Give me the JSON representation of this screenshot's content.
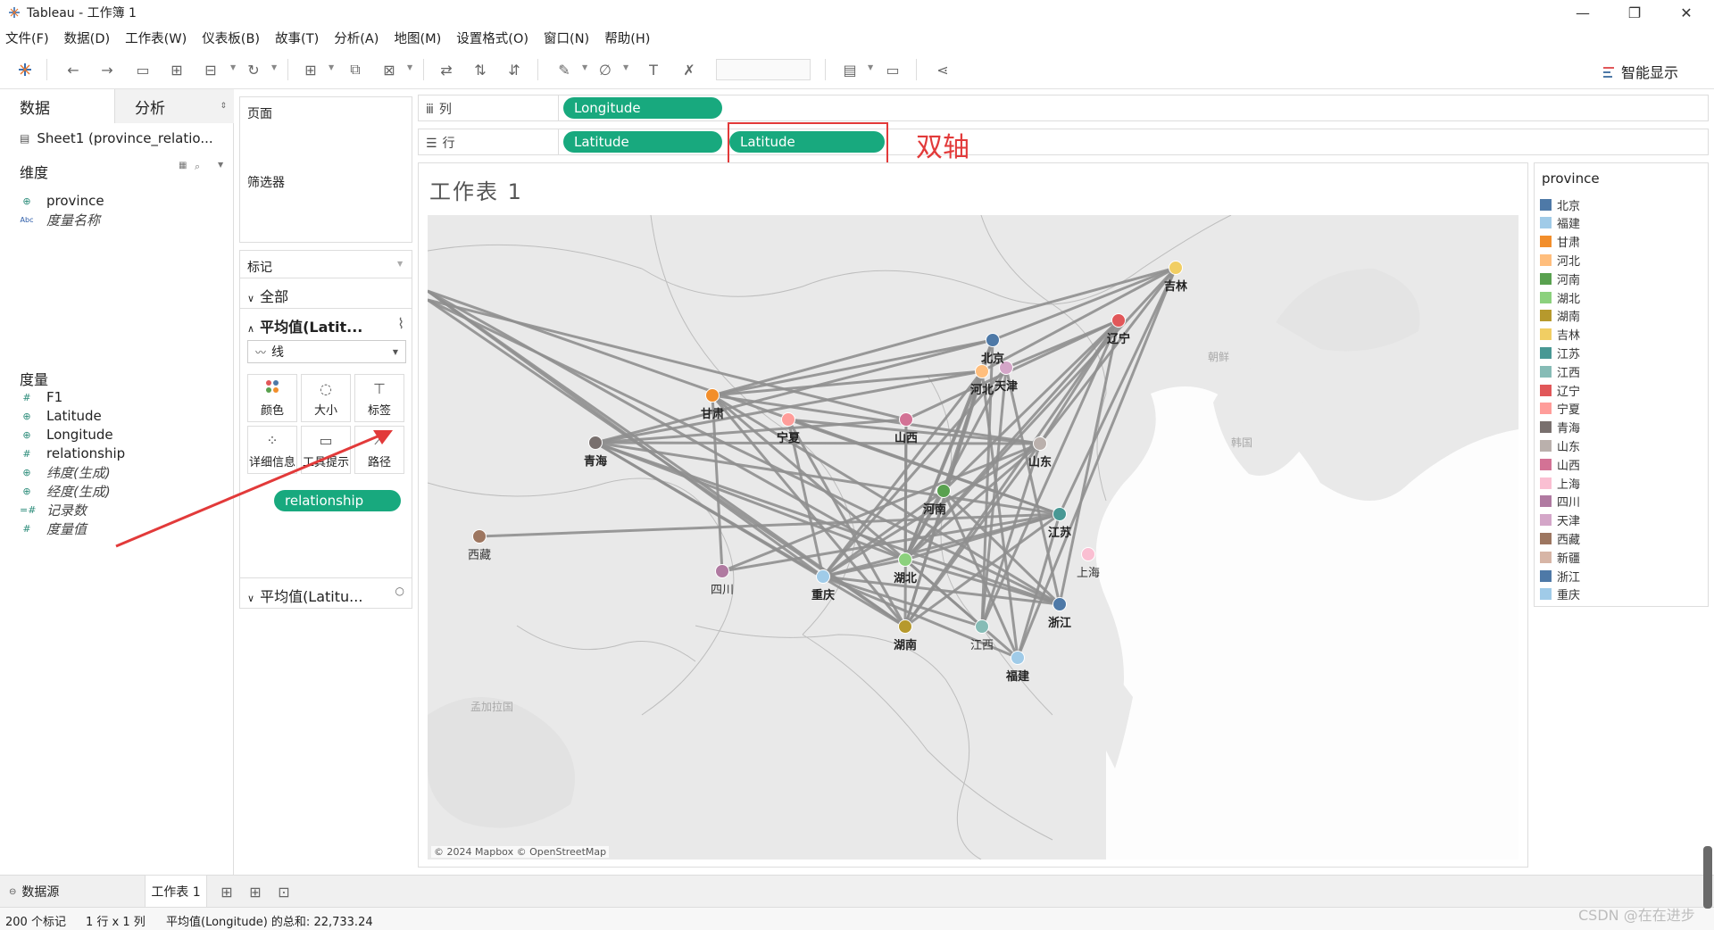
{
  "window": {
    "title": "Tableau - 工作簿 1",
    "minimize": "—",
    "maximize": "❐",
    "close": "✕"
  },
  "menu": [
    "文件(F)",
    "数据(D)",
    "工作表(W)",
    "仪表板(B)",
    "故事(T)",
    "分析(A)",
    "地图(M)",
    "设置格式(O)",
    "窗口(N)",
    "帮助(H)"
  ],
  "toolbar": {
    "show_me": "智能显示"
  },
  "left_pane": {
    "tab_data": "数据",
    "tab_analysis": "分析",
    "datasource": "Sheet1 (province_relatio...",
    "dimensions_header": "维度",
    "dimensions": [
      {
        "icon": "⊕",
        "label": "province",
        "italic": false
      },
      {
        "icon": "Abc",
        "label": "度量名称",
        "italic": true
      }
    ],
    "measures_header": "度量",
    "measures": [
      {
        "icon": "#",
        "label": "F1",
        "italic": false
      },
      {
        "icon": "⊕",
        "label": "Latitude",
        "italic": false
      },
      {
        "icon": "⊕",
        "label": "Longitude",
        "italic": false
      },
      {
        "icon": "#",
        "label": "relationship",
        "italic": false
      },
      {
        "icon": "⊕",
        "label": "纬度(生成)",
        "italic": true
      },
      {
        "icon": "⊕",
        "label": "经度(生成)",
        "italic": true
      },
      {
        "icon": "=#",
        "label": "记录数",
        "italic": true
      },
      {
        "icon": "#",
        "label": "度量值",
        "italic": true
      }
    ]
  },
  "cards": {
    "pages": "页面",
    "filters": "筛选器",
    "marks": "标记",
    "all": "全部",
    "avg_lat_1": "平均值(Latit...",
    "mark_type": "线",
    "buttons": {
      "color": "颜色",
      "size": "大小",
      "label": "标签",
      "detail": "详细信息",
      "tooltip": "工具提示",
      "path": "路径"
    },
    "path_pill": "relationship",
    "avg_lat_2": "平均值(Latitu..."
  },
  "shelves": {
    "columns_label": "列",
    "rows_label": "行",
    "columns_pill": "Longitude",
    "rows_pill_1": "Latitude",
    "rows_pill_2": "Latitude",
    "annotation": "双轴"
  },
  "viz": {
    "sheet_title": "工作表 1",
    "map_copyright": "© 2024 Mapbox © OpenStreetMap",
    "bg_labels": [
      "朝鲜",
      "韩国",
      "孟加拉国"
    ],
    "cities": [
      {
        "name": "北京",
        "color": "#4e79a7",
        "bold": true
      },
      {
        "name": "天津",
        "color": "#d4a6c8",
        "bold": true
      },
      {
        "name": "河北",
        "color": "#ffbe7d",
        "bold": true
      },
      {
        "name": "辽宁",
        "color": "#e15759",
        "bold": true
      },
      {
        "name": "吉林",
        "color": "#f1ce63",
        "bold": true
      },
      {
        "name": "甘肃",
        "color": "#f28e2b",
        "bold": true
      },
      {
        "name": "宁夏",
        "color": "#ff9d9a",
        "bold": true
      },
      {
        "name": "山西",
        "color": "#d37295",
        "bold": true
      },
      {
        "name": "青海",
        "color": "#79706e",
        "bold": true
      },
      {
        "name": "山东",
        "color": "#bab0ac",
        "bold": true
      },
      {
        "name": "河南",
        "color": "#59a14f",
        "bold": true
      },
      {
        "name": "江苏",
        "color": "#499894",
        "bold": true
      },
      {
        "name": "上海",
        "color": "#fabfd2",
        "bold": false
      },
      {
        "name": "西藏",
        "color": "#9d7660",
        "bold": false
      },
      {
        "name": "四川",
        "color": "#b07aa1",
        "bold": false
      },
      {
        "name": "重庆",
        "color": "#a0cbe8",
        "bold": true
      },
      {
        "name": "湖北",
        "color": "#8cd17d",
        "bold": true
      },
      {
        "name": "湖南",
        "color": "#b6992d",
        "bold": true
      },
      {
        "name": "江西",
        "color": "#86bcb6",
        "bold": false
      },
      {
        "name": "浙江",
        "color": "#4e79a7",
        "bold": true
      },
      {
        "name": "福建",
        "color": "#a0cbe8",
        "bold": true
      }
    ],
    "links": [
      [
        "新疆A",
        "湖北"
      ],
      [
        "新疆A",
        "重庆"
      ],
      [
        "新疆A",
        "湖南"
      ],
      [
        "新疆A",
        "江苏"
      ],
      [
        "新疆B",
        "山西"
      ],
      [
        "新疆B",
        "浙江"
      ],
      [
        "新疆B",
        "湖南"
      ],
      [
        "吉林",
        "北京"
      ],
      [
        "吉林",
        "甘肃"
      ],
      [
        "吉林",
        "河北"
      ],
      [
        "吉林",
        "江苏"
      ],
      [
        "吉林",
        "山东"
      ],
      [
        "吉林",
        "湖北"
      ],
      [
        "吉林",
        "福建"
      ],
      [
        "辽宁",
        "天津"
      ],
      [
        "辽宁",
        "山西"
      ],
      [
        "辽宁",
        "湖北"
      ],
      [
        "辽宁",
        "湖南"
      ],
      [
        "辽宁",
        "江西"
      ],
      [
        "辽宁",
        "浙江"
      ],
      [
        "辽宁",
        "山东"
      ],
      [
        "辽宁",
        "河南"
      ],
      [
        "北京",
        "甘肃"
      ],
      [
        "北京",
        "青海"
      ],
      [
        "北京",
        "湖北"
      ],
      [
        "北京",
        "江西"
      ],
      [
        "北京",
        "河南"
      ],
      [
        "北京",
        "湖南"
      ],
      [
        "天津",
        "湖北"
      ],
      [
        "天津",
        "重庆"
      ],
      [
        "天津",
        "浙江"
      ],
      [
        "天津",
        "江西"
      ],
      [
        "河北",
        "青海"
      ],
      [
        "河北",
        "湖北"
      ],
      [
        "河北",
        "重庆"
      ],
      [
        "河北",
        "湖南"
      ],
      [
        "河北",
        "福建"
      ],
      [
        "甘肃",
        "山东"
      ],
      [
        "甘肃",
        "湖北"
      ],
      [
        "甘肃",
        "湖南"
      ],
      [
        "甘肃",
        "四川"
      ],
      [
        "甘肃",
        "浙江"
      ],
      [
        "甘肃",
        "河北"
      ],
      [
        "宁夏",
        "湖南"
      ],
      [
        "宁夏",
        "重庆"
      ],
      [
        "宁夏",
        "山东"
      ],
      [
        "宁夏",
        "江苏"
      ],
      [
        "青海",
        "江苏"
      ],
      [
        "青海",
        "山东"
      ],
      [
        "青海",
        "湖北"
      ],
      [
        "青海",
        "湖南"
      ],
      [
        "青海",
        "重庆"
      ],
      [
        "青海",
        "浙江"
      ],
      [
        "青海",
        "山西"
      ],
      [
        "山东",
        "湖北"
      ],
      [
        "山东",
        "重庆"
      ],
      [
        "山东",
        "江西"
      ],
      [
        "山东",
        "湖南"
      ],
      [
        "山东",
        "四川"
      ],
      [
        "江苏",
        "重庆"
      ],
      [
        "江苏",
        "湖北"
      ],
      [
        "江苏",
        "湖南"
      ],
      [
        "江苏",
        "福建"
      ],
      [
        "江苏",
        "西藏"
      ],
      [
        "江苏",
        "四川"
      ],
      [
        "河南",
        "重庆"
      ],
      [
        "河南",
        "湖北"
      ],
      [
        "河南",
        "福建"
      ],
      [
        "河南",
        "浙江"
      ],
      [
        "湖北",
        "浙江"
      ],
      [
        "湖北",
        "江西"
      ],
      [
        "湖北",
        "重庆"
      ],
      [
        "湖北",
        "福建"
      ],
      [
        "浙江",
        "重庆"
      ],
      [
        "山西",
        "湖北"
      ],
      [
        "山西",
        "湖南"
      ],
      [
        "重庆",
        "福建"
      ],
      [
        "江西",
        "重庆"
      ]
    ]
  },
  "legend": {
    "title": "province",
    "items": [
      {
        "label": "北京",
        "color": "#4e79a7"
      },
      {
        "label": "福建",
        "color": "#a0cbe8"
      },
      {
        "label": "甘肃",
        "color": "#f28e2b"
      },
      {
        "label": "河北",
        "color": "#ffbe7d"
      },
      {
        "label": "河南",
        "color": "#59a14f"
      },
      {
        "label": "湖北",
        "color": "#8cd17d"
      },
      {
        "label": "湖南",
        "color": "#b6992d"
      },
      {
        "label": "吉林",
        "color": "#f1ce63"
      },
      {
        "label": "江苏",
        "color": "#499894"
      },
      {
        "label": "江西",
        "color": "#86bcb6"
      },
      {
        "label": "辽宁",
        "color": "#e15759"
      },
      {
        "label": "宁夏",
        "color": "#ff9d9a"
      },
      {
        "label": "青海",
        "color": "#79706e"
      },
      {
        "label": "山东",
        "color": "#bab0ac"
      },
      {
        "label": "山西",
        "color": "#d37295"
      },
      {
        "label": "上海",
        "color": "#fabfd2"
      },
      {
        "label": "四川",
        "color": "#b07aa1"
      },
      {
        "label": "天津",
        "color": "#d4a6c8"
      },
      {
        "label": "西藏",
        "color": "#9d7660"
      },
      {
        "label": "新疆",
        "color": "#d7b5a6"
      },
      {
        "label": "浙江",
        "color": "#4e79a7"
      },
      {
        "label": "重庆",
        "color": "#a0cbe8"
      }
    ]
  },
  "bottom": {
    "datasource_tab": "数据源",
    "sheet_tab": "工作表 1",
    "status_marks": "200 个标记",
    "status_rows": "1 行 x 1 列",
    "status_sum": "平均值(Longitude) 的总和: 22,733.24",
    "watermark": "CSDN @在在进步"
  }
}
